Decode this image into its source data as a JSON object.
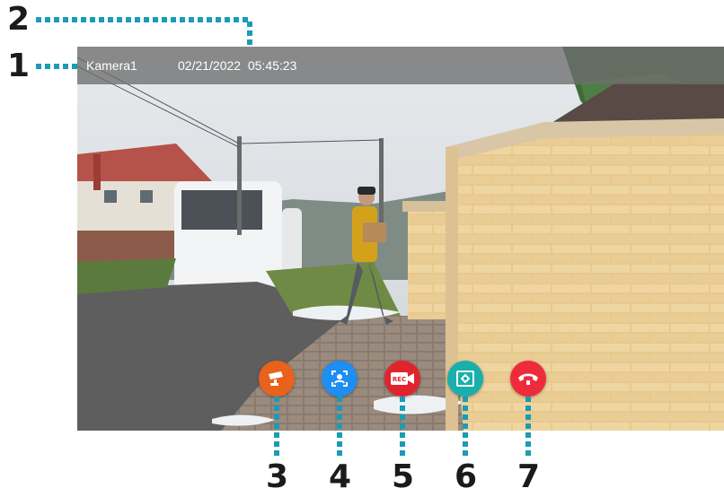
{
  "status_bar": {
    "camera_name": "Kamera1",
    "date": "02/21/2022",
    "time": "05:45:23"
  },
  "controls": [
    {
      "id": "monitor",
      "icon": "cctv-camera-icon",
      "color": "#e8621c"
    },
    {
      "id": "snapshot",
      "icon": "face-capture-icon",
      "color": "#1e8ef0"
    },
    {
      "id": "record",
      "icon": "rec-camera-icon",
      "color": "#e0242e",
      "label": "REC"
    },
    {
      "id": "settings",
      "icon": "settings-screen-icon",
      "color": "#1aafaa"
    },
    {
      "id": "hangup",
      "icon": "hang-up-phone-icon",
      "color": "#ee2b3a"
    }
  ],
  "callouts": {
    "n1": "1",
    "n2": "2",
    "n3": "3",
    "n4": "4",
    "n5": "5",
    "n6": "6",
    "n7": "7",
    "color": "#1a9cb5"
  }
}
